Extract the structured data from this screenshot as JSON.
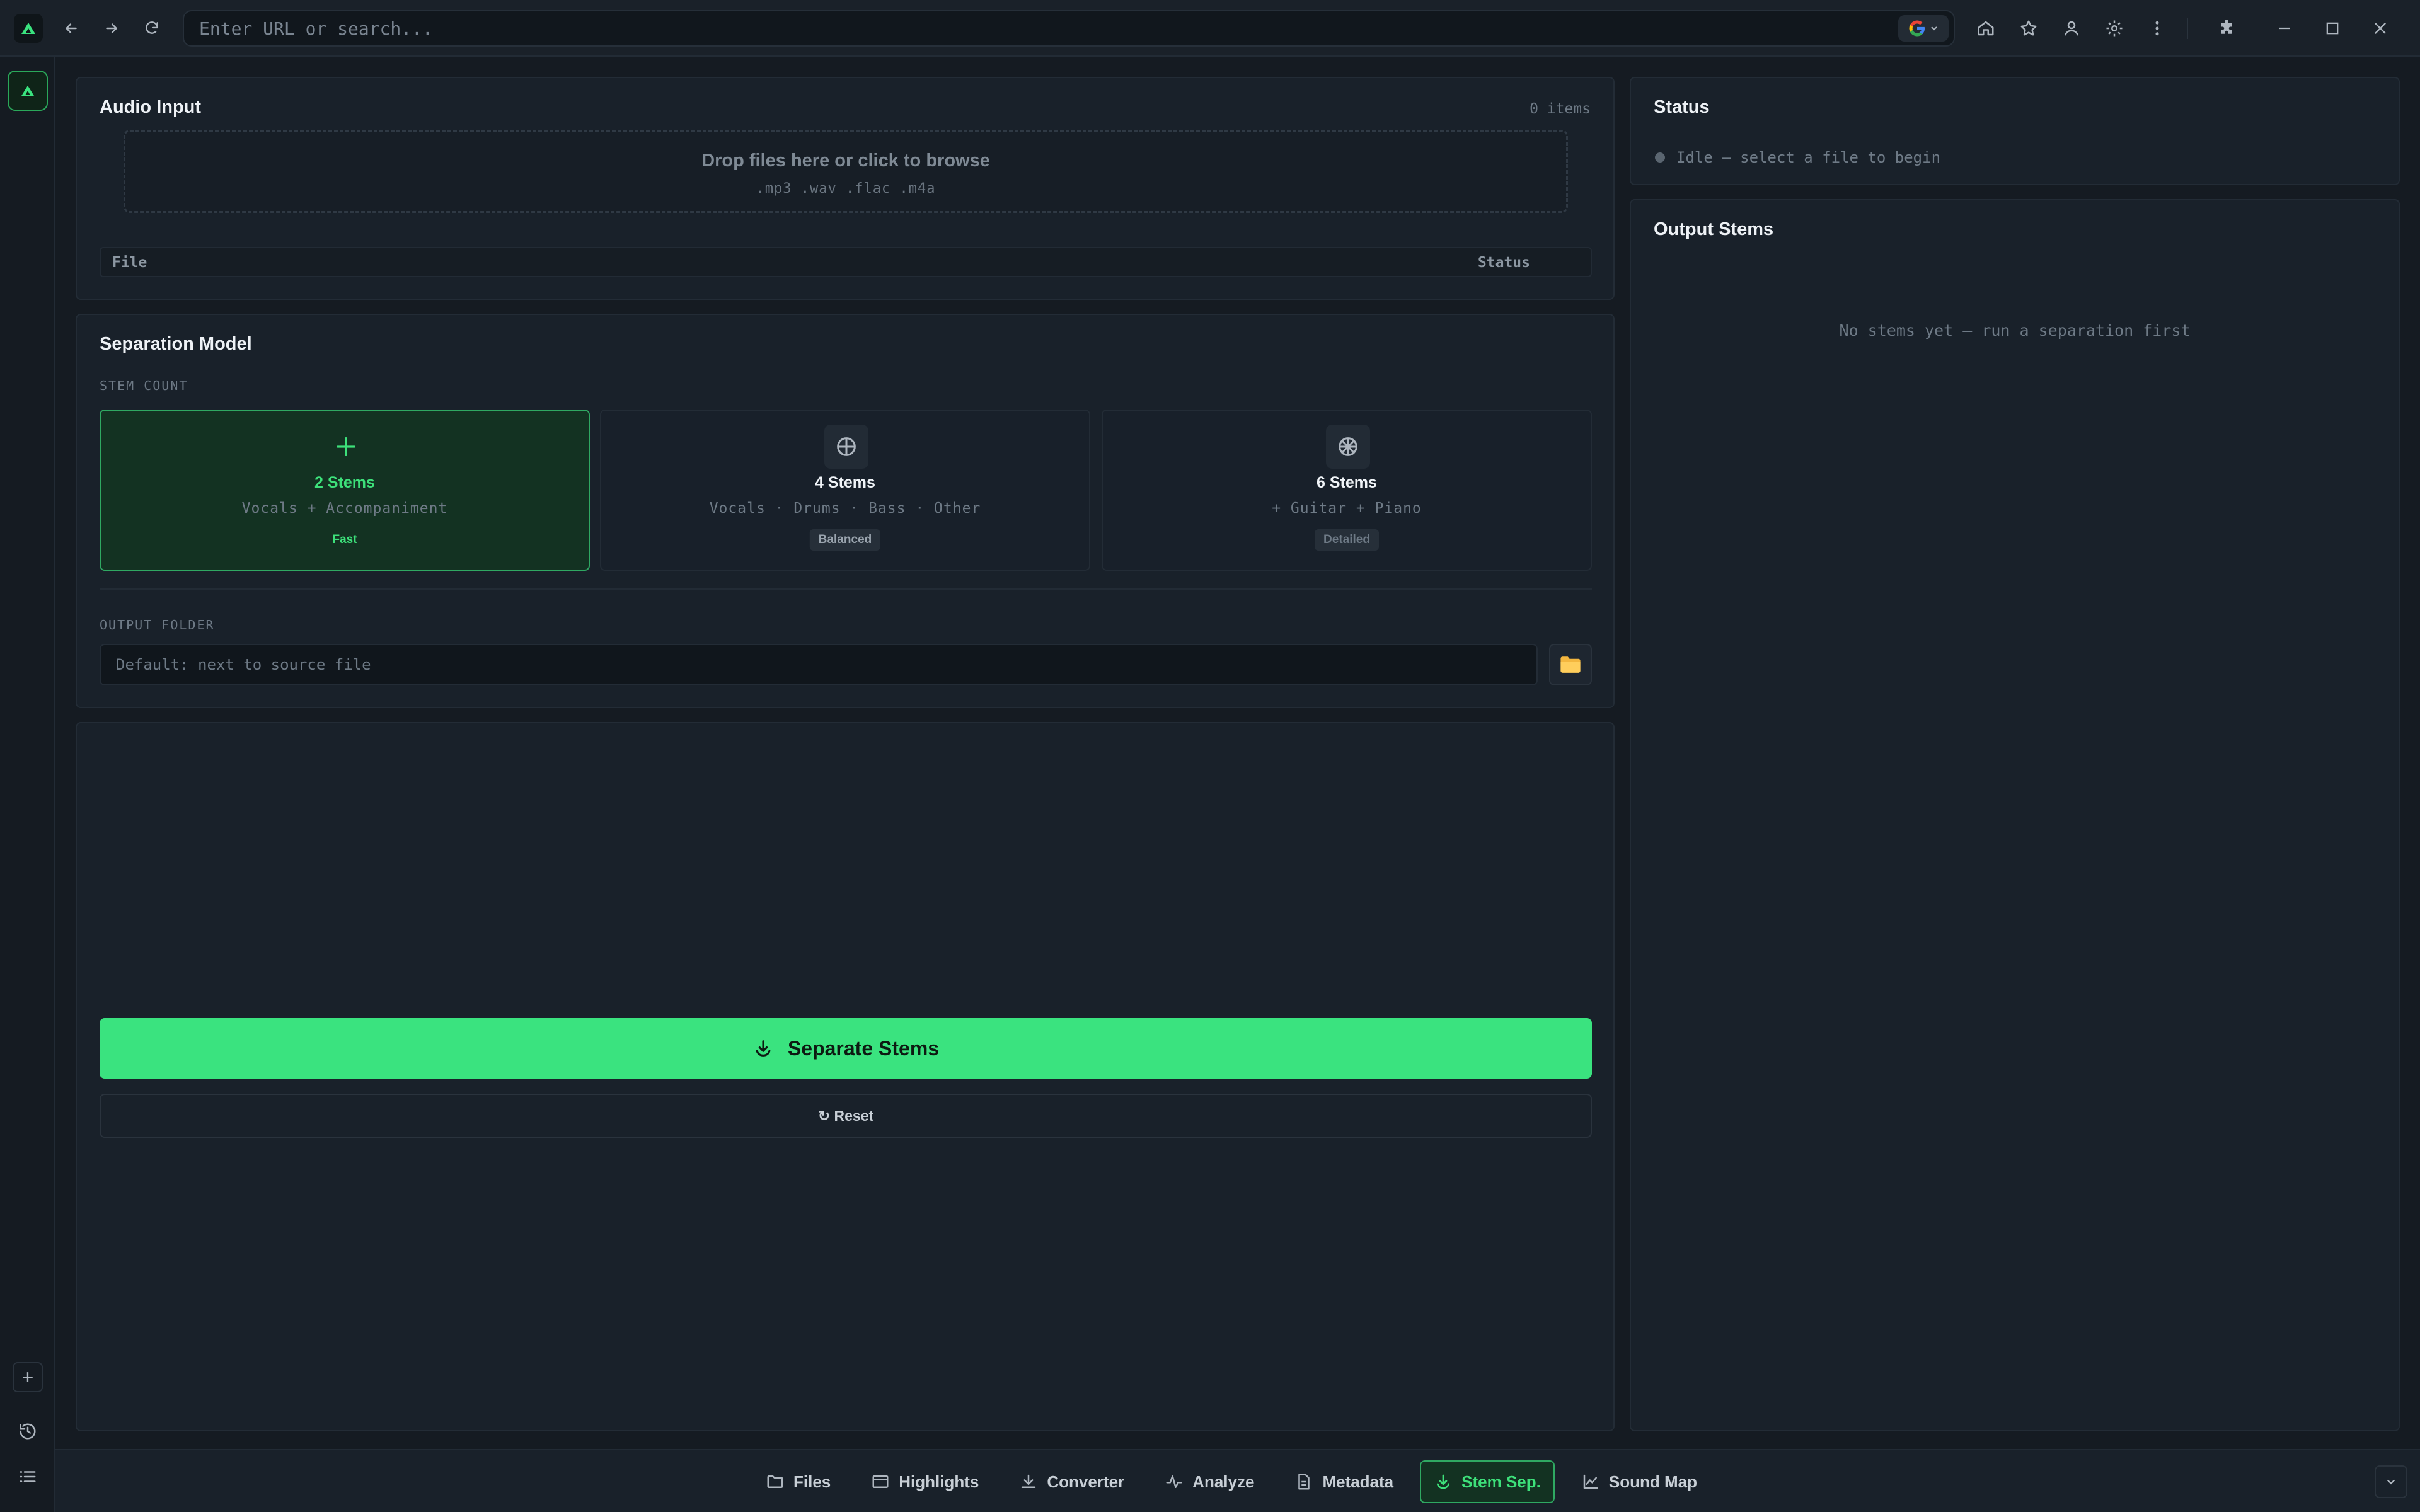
{
  "browser": {
    "url_placeholder": "Enter URL or search...",
    "url_value": "",
    "icons": {
      "back": "arrow-left-icon",
      "forward": "arrow-right-icon",
      "reload": "reload-icon",
      "search_engine": "google-icon",
      "home": "home-icon",
      "bookmark": "star-icon",
      "profile": "user-icon",
      "settings": "gear-icon",
      "menu": "kebab-menu-icon",
      "extensions": "puzzle-icon",
      "minimize": "minimize-icon",
      "maximize": "maximize-icon",
      "close": "close-icon"
    }
  },
  "sidebar": {
    "add_label": "+",
    "icons": [
      "history-icon",
      "list-icon"
    ]
  },
  "audio_input": {
    "title": "Audio Input",
    "items_count": "0 items",
    "drop_title": "Drop files here or click to browse",
    "drop_types": ".mp3  .wav  .flac  .m4a",
    "columns": [
      "File",
      "Status"
    ]
  },
  "model": {
    "title": "Separation Model",
    "stem_count_label": "STEM COUNT",
    "options": [
      {
        "name": "2 Stems",
        "desc": "Vocals + Accompaniment",
        "badge": "Fast",
        "selected": true
      },
      {
        "name": "4 Stems",
        "desc": "Vocals · Drums · Bass · Other",
        "badge": "Balanced",
        "selected": false
      },
      {
        "name": "6 Stems",
        "desc": "+ Guitar + Piano",
        "badge": "Detailed",
        "selected": false
      }
    ],
    "output_folder_label": "OUTPUT FOLDER",
    "output_folder_placeholder": "Default: next to source file",
    "output_folder_value": ""
  },
  "actions": {
    "separate_label": "Separate Stems",
    "reset_label": "↻ Reset"
  },
  "status": {
    "title": "Status",
    "text": "Idle — select a file to begin"
  },
  "output": {
    "title": "Output Stems",
    "empty": "No stems yet — run a separation first"
  },
  "tabs": [
    {
      "label": "Files",
      "icon": "folder-icon",
      "active": false
    },
    {
      "label": "Highlights",
      "icon": "highlights-icon",
      "active": false
    },
    {
      "label": "Converter",
      "icon": "download-icon",
      "active": false
    },
    {
      "label": "Analyze",
      "icon": "pulse-icon",
      "active": false
    },
    {
      "label": "Metadata",
      "icon": "document-icon",
      "active": false
    },
    {
      "label": "Stem Sep.",
      "icon": "stem-icon",
      "active": true
    },
    {
      "label": "Sound Map",
      "icon": "chart-icon",
      "active": false
    }
  ],
  "colors": {
    "accent": "#3ae37f",
    "background": "#151b22",
    "panel": "#19212a"
  }
}
